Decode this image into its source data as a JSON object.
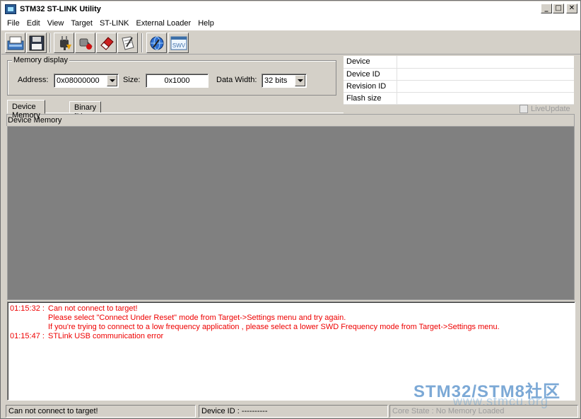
{
  "window": {
    "title": "STM32 ST-LINK Utility"
  },
  "menu": {
    "items": [
      "File",
      "Edit",
      "View",
      "Target",
      "ST-LINK",
      "External Loader",
      "Help"
    ]
  },
  "toolbar": {
    "buttons": [
      "open-file-icon",
      "save-icon",
      "connect-icon",
      "disconnect-icon",
      "erase-icon",
      "program-icon",
      "firmware-update-icon",
      "swv-icon"
    ],
    "swv_label": "SWV"
  },
  "memory_display": {
    "group_label": "Memory display",
    "address_label": "Address:",
    "address_value": "0x08000000",
    "size_label": "Size:",
    "size_value": "0x1000",
    "data_width_label": "Data Width:",
    "data_width_value": "32 bits"
  },
  "device_info": {
    "rows": [
      {
        "key": "Device",
        "value": ""
      },
      {
        "key": "Device ID",
        "value": ""
      },
      {
        "key": "Revision ID",
        "value": ""
      },
      {
        "key": "Flash size",
        "value": ""
      }
    ]
  },
  "tabs": {
    "device_memory": "Device Memory",
    "binary_file": "Binary File"
  },
  "live_update": {
    "label": "LiveUpdate",
    "checked": false
  },
  "memory_view": {
    "header": "Device Memory"
  },
  "log": {
    "lines": [
      {
        "time": "01:15:32 :",
        "text": "Can not connect to target!"
      },
      {
        "time": "",
        "text": "Please select \"Connect Under Reset\" mode from Target->Settings menu and try again."
      },
      {
        "time": "",
        "text": "If you're trying to connect to a low frequency application , please select a lower SWD Frequency mode from Target->Settings menu."
      },
      {
        "time": "01:15:47 :",
        "text": "STLink USB communication error"
      }
    ],
    "color": "#ee0000"
  },
  "watermark": {
    "line1": "STM32/STM8社区",
    "line2": "www.stmcu.org"
  },
  "status": {
    "message": "Can not connect to target!",
    "device_id": "Device ID : ----------",
    "core_state": "Core State : No Memory Loaded"
  }
}
